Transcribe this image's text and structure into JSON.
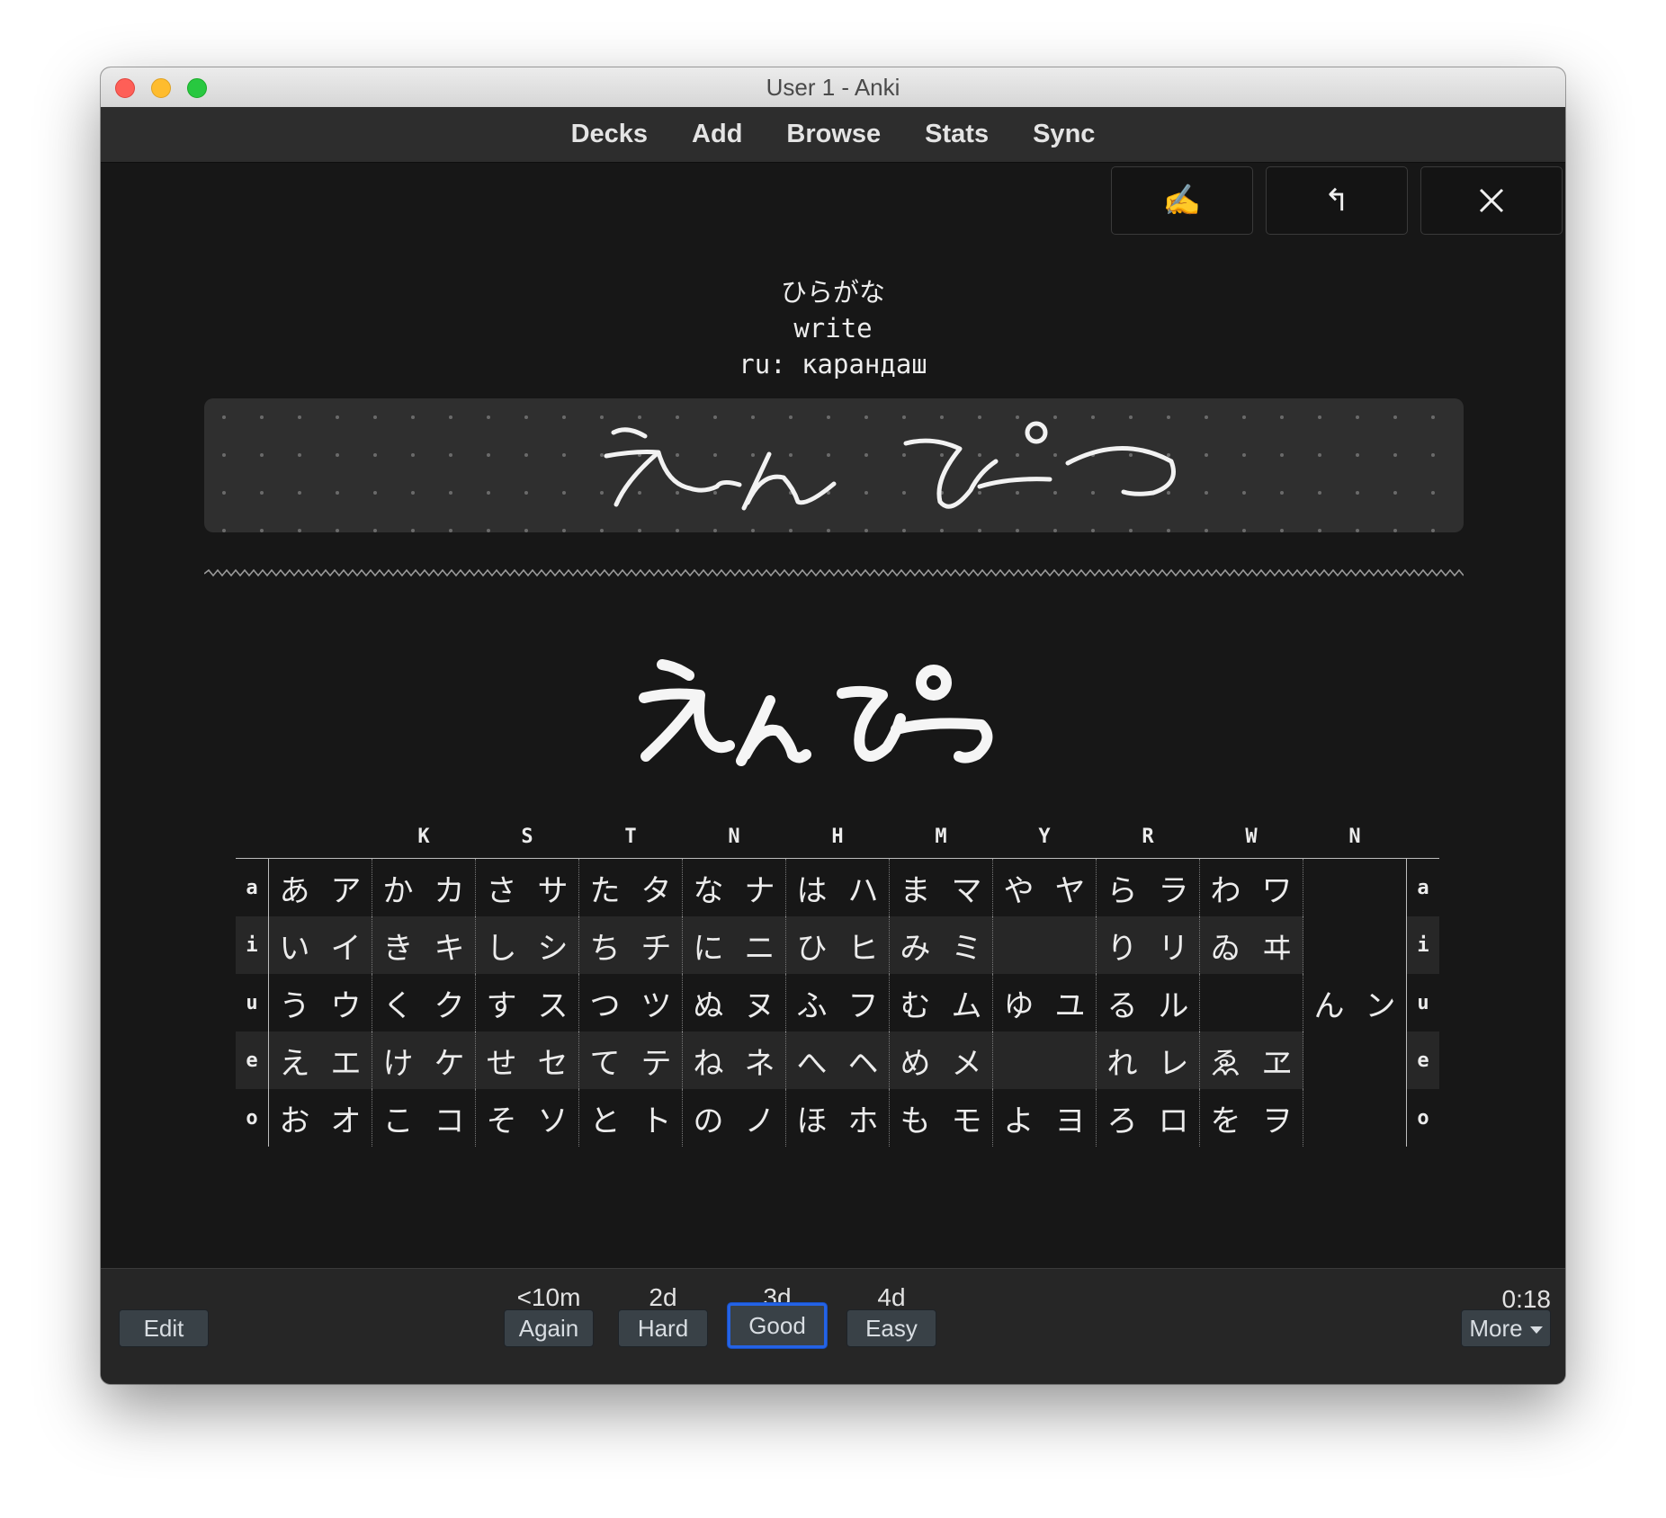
{
  "window": {
    "title": "User 1 - Anki"
  },
  "toolbar": {
    "items": [
      "Decks",
      "Add",
      "Browse",
      "Stats",
      "Sync"
    ]
  },
  "tool_buttons": {
    "draw_icon": "writing-hand-icon",
    "undo_icon": "undo-icon",
    "close_icon": "close-icon",
    "draw_glyph": "✍️",
    "undo_glyph": "↰"
  },
  "card": {
    "prompt_line1": "ひらがな",
    "prompt_line2": "write",
    "prompt_line3": "ru: карандаш",
    "answer": "えんぴつ"
  },
  "kana_table": {
    "columns": [
      "",
      "K",
      "S",
      "T",
      "N",
      "H",
      "M",
      "Y",
      "R",
      "W",
      "N"
    ],
    "rows": [
      {
        "label": "a",
        "cells": [
          [
            "あ",
            "ア"
          ],
          [
            "か",
            "カ"
          ],
          [
            "さ",
            "サ"
          ],
          [
            "た",
            "タ"
          ],
          [
            "な",
            "ナ"
          ],
          [
            "は",
            "ハ"
          ],
          [
            "ま",
            "マ"
          ],
          [
            "や",
            "ヤ"
          ],
          [
            "ら",
            "ラ"
          ],
          [
            "わ",
            "ワ"
          ]
        ]
      },
      {
        "label": "i",
        "cells": [
          [
            "い",
            "イ"
          ],
          [
            "き",
            "キ"
          ],
          [
            "し",
            "シ"
          ],
          [
            "ち",
            "チ"
          ],
          [
            "に",
            "ニ"
          ],
          [
            "ひ",
            "ヒ"
          ],
          [
            "み",
            "ミ"
          ],
          [
            "",
            ""
          ],
          [
            "り",
            "リ"
          ],
          [
            "ゐ",
            "ヰ"
          ]
        ]
      },
      {
        "label": "u",
        "cells": [
          [
            "う",
            "ウ"
          ],
          [
            "く",
            "ク"
          ],
          [
            "す",
            "ス"
          ],
          [
            "つ",
            "ツ"
          ],
          [
            "ぬ",
            "ヌ"
          ],
          [
            "ふ",
            "フ"
          ],
          [
            "む",
            "ム"
          ],
          [
            "ゆ",
            "ユ"
          ],
          [
            "る",
            "ル"
          ],
          [
            "",
            ""
          ]
        ]
      },
      {
        "label": "e",
        "cells": [
          [
            "え",
            "エ"
          ],
          [
            "け",
            "ケ"
          ],
          [
            "せ",
            "セ"
          ],
          [
            "て",
            "テ"
          ],
          [
            "ね",
            "ネ"
          ],
          [
            "へ",
            "ヘ"
          ],
          [
            "め",
            "メ"
          ],
          [
            "",
            ""
          ],
          [
            "れ",
            "レ"
          ],
          [
            "ゑ",
            "ヱ"
          ]
        ]
      },
      {
        "label": "o",
        "cells": [
          [
            "お",
            "オ"
          ],
          [
            "こ",
            "コ"
          ],
          [
            "そ",
            "ソ"
          ],
          [
            "と",
            "ト"
          ],
          [
            "の",
            "ノ"
          ],
          [
            "ほ",
            "ホ"
          ],
          [
            "も",
            "モ"
          ],
          [
            "よ",
            "ヨ"
          ],
          [
            "ろ",
            "ロ"
          ],
          [
            "を",
            "ヲ"
          ]
        ]
      }
    ],
    "n_cell": [
      "ん",
      "ン"
    ]
  },
  "bottom_bar": {
    "edit_label": "Edit",
    "answers": [
      {
        "interval": "<10m",
        "label": "Again"
      },
      {
        "interval": "2d",
        "label": "Hard"
      },
      {
        "interval": "3d",
        "label": "Good"
      },
      {
        "interval": "4d",
        "label": "Easy"
      }
    ],
    "timer": "0:18",
    "more_label": "More"
  },
  "colors": {
    "focus": "#2463e6",
    "background": "#171717"
  }
}
